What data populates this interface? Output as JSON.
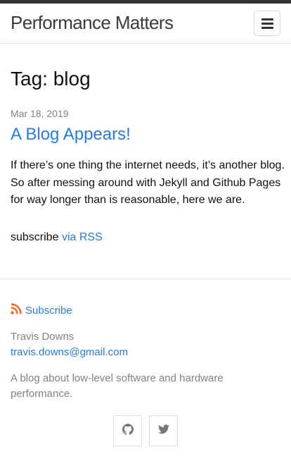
{
  "header": {
    "site_title": "Performance Matters",
    "menu_icon": "hamburger-icon"
  },
  "page": {
    "heading": "Tag: blog"
  },
  "posts": [
    {
      "date": "Mar 18, 2019",
      "title": "A Blog Appears!",
      "excerpt": "If there’s one thing the internet needs, it’s another blog. So after messing around with Jekyll and Github Pages for way longer than is reasonable, here we are."
    }
  ],
  "subscribe_line": {
    "prefix": "subscribe",
    "link": "via RSS"
  },
  "footer": {
    "subscribe_label": "Subscribe",
    "author_name": "Travis Downs",
    "email": "travis.downs@gmail.com",
    "description": "A blog about low-level software and hardware performance.",
    "social": [
      "github-icon",
      "twitter-icon"
    ]
  },
  "colors": {
    "link": "#2a7ae2",
    "muted": "#828282",
    "rss": "#f26522",
    "topbar": "#333333"
  }
}
